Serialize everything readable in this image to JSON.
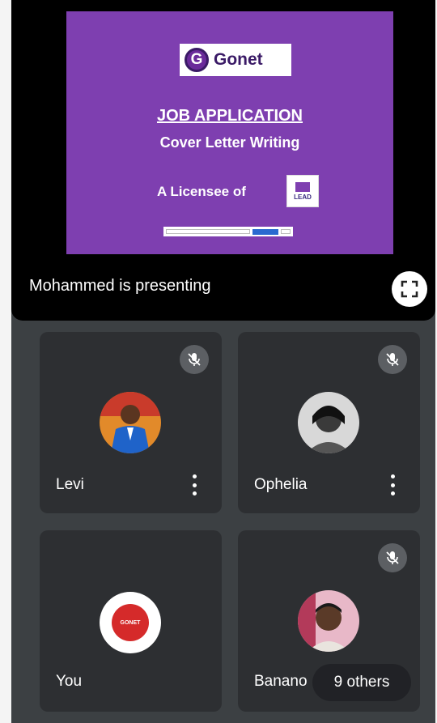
{
  "slide": {
    "logo_letter": "G",
    "logo_text": "Gonet",
    "title": "JOB APPLICATION",
    "subtitle": "Cover Letter Writing",
    "licensee_text": "A Licensee of",
    "partner_logo_text": "LEAD"
  },
  "presentation": {
    "presenter_label": "Mohammed is presenting",
    "fullscreen_icon": "fullscreen-icon"
  },
  "participants": [
    {
      "name": "Levi",
      "muted": true
    },
    {
      "name": "Ophelia",
      "muted": true
    },
    {
      "name": "You",
      "muted": false,
      "badge_text": "GONET"
    },
    {
      "name": "Banano",
      "muted": true
    }
  ],
  "others_label": "9 others",
  "colors": {
    "slide_bg": "#7e3fb0",
    "tile_bg": "#2d2f32",
    "grid_bg": "#3c4043",
    "muted_badge": "#5c5f63"
  }
}
